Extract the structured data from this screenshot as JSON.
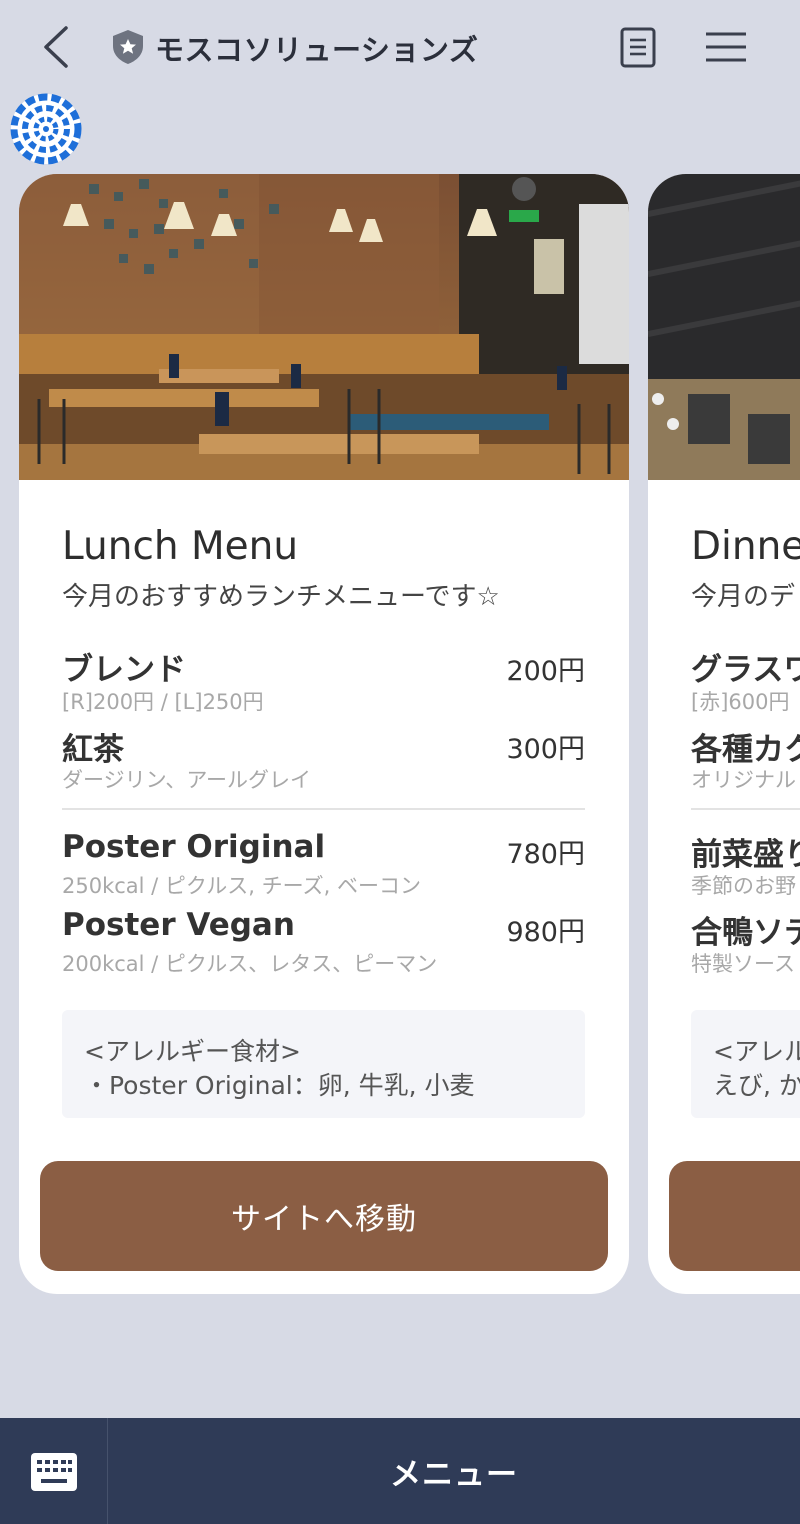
{
  "header": {
    "title": "モスコソリューションズ",
    "icons": {
      "back": "chevron-left-icon",
      "badge": "shield-star-icon",
      "notes": "notes-icon",
      "menu": "hamburger-icon"
    }
  },
  "cards": [
    {
      "title": "Lunch Menu",
      "subtitle": "今月のおすすめランチメニューです☆",
      "items": [
        {
          "name": "ブレンド",
          "price": "200円",
          "desc": "[R]200円 / [L]250円"
        },
        {
          "name": "紅茶",
          "price": "300円",
          "desc": "ダージリン、アールグレイ"
        },
        {
          "name": "Poster Original",
          "price": "780円",
          "desc": "250kcal / ピクルス, チーズ, ベーコン"
        },
        {
          "name": "Poster Vegan",
          "price": "980円",
          "desc": "200kcal / ピクルス、レタス、ピーマン"
        }
      ],
      "allergy_title": "<アレルギー食材>",
      "allergy_line": "・Poster Original：卵, 牛乳, 小麦",
      "button_label": "サイトへ移動"
    },
    {
      "title": "Dinne",
      "subtitle": "今月のデ",
      "items": [
        {
          "name": "グラスワ",
          "desc": "[赤]600円"
        },
        {
          "name": "各種カク",
          "desc": "オリジナル"
        },
        {
          "name": "前菜盛り",
          "desc": "季節のお野"
        },
        {
          "name": "合鴨ソテ",
          "desc": "特製ソース"
        }
      ],
      "allergy_title": "<アレル",
      "allergy_line": "えび, か"
    }
  ],
  "bottom_bar": {
    "menu_label": "メニュー",
    "keyboard_icon": "keyboard-icon"
  },
  "colors": {
    "background": "#d7dae5",
    "button": "#8b5e44",
    "bottom_bar": "#2f3b57"
  }
}
